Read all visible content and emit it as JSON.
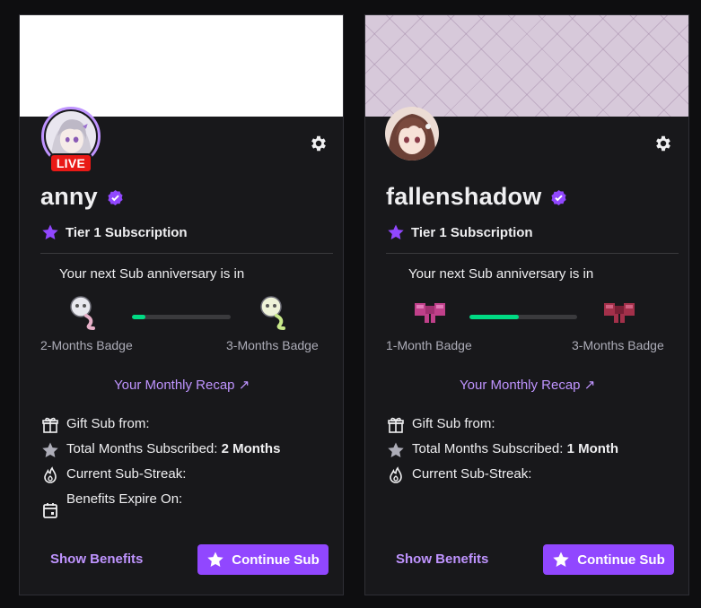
{
  "cards": [
    {
      "streamer": "anny",
      "live_label": "LIVE",
      "tier": "Tier 1 Subscription",
      "next_anniversary_text": "Your next Sub anniversary is in",
      "progress_fraction": 0.14,
      "current_badge_label": "2-Months Badge",
      "next_badge_label": "3-Months Badge",
      "recap_label": "Your Monthly Recap ↗",
      "gift_sub_label": "Gift Sub from:",
      "total_months_label": "Total Months Subscribed:",
      "total_months_value": "2 Months",
      "streak_label": "Current Sub-Streak:",
      "benefits_expire_label": "Benefits Expire On:",
      "show_benefits_label": "Show Benefits",
      "continue_label": "Continue Sub"
    },
    {
      "streamer": "fallenshadow",
      "tier": "Tier 1 Subscription",
      "next_anniversary_text": "Your next Sub anniversary is in",
      "progress_fraction": 0.46,
      "current_badge_label": "1-Month Badge",
      "next_badge_label": "3-Months Badge",
      "recap_label": "Your Monthly Recap ↗",
      "gift_sub_label": "Gift Sub from:",
      "total_months_label": "Total Months Subscribed:",
      "total_months_value": "1 Month",
      "streak_label": "Current Sub-Streak:",
      "show_benefits_label": "Show Benefits",
      "continue_label": "Continue Sub"
    }
  ],
  "colors": {
    "accent": "#9147ff",
    "accent_text": "#bf94ff",
    "progress": "#00db84",
    "live": "#e91916",
    "card_bg": "#18181b",
    "page_bg": "#0e0e10"
  }
}
